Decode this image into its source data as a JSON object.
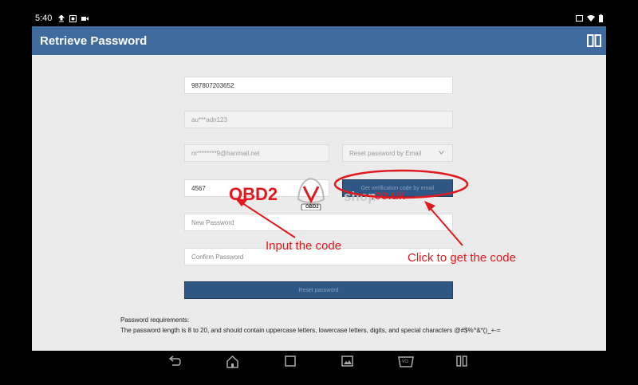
{
  "status_bar": {
    "time": "5:40",
    "icons_left": [
      "upload-icon",
      "settings-icon",
      "record-icon"
    ],
    "icons_right": [
      "cast-icon",
      "wifi-icon",
      "battery-icon"
    ]
  },
  "app_bar": {
    "title": "Retrieve Password",
    "split_icon": "split-screen-icon"
  },
  "form": {
    "phone_value": "987807203652",
    "username_value": "au***adn123",
    "email_value": "m********9@hanmail.net",
    "reset_method": "Reset password by Email",
    "code_value": "4567",
    "get_code_label": "Get verification code by email",
    "new_password_placeholder": "New Password",
    "confirm_password_placeholder": "Confirm Password",
    "reset_button_label": "Reset password"
  },
  "requirements": {
    "heading": "Password requirements:",
    "text": "The password length is 8 to 20, and should contain uppercase letters, lowercase letters, digits, and special characters @#$%^&*()_+-="
  },
  "annotations": {
    "input_code": "Input the code",
    "click_code": "Click to get the code",
    "color": "#e0191f"
  },
  "watermark": {
    "brand": "OBD2",
    "badge": "OBD2",
    "shop": "shop",
    "domain": ".co.uk"
  },
  "nav_bar": {
    "icons": [
      "back-icon",
      "home-icon",
      "recents-icon",
      "screenshot-icon",
      "vci-icon",
      "split-screen-nav-icon"
    ],
    "vci_label": "VCI"
  },
  "colors": {
    "app_bar": "#3e6a9e",
    "button": "#2f5785",
    "content_bg": "#ebebeb"
  }
}
